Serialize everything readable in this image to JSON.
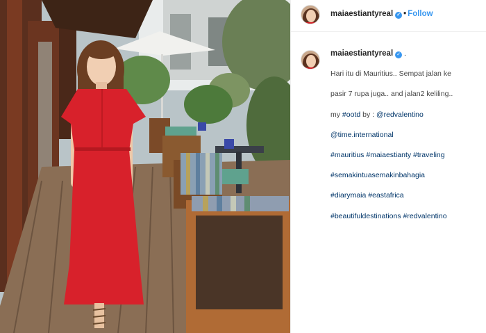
{
  "post": {
    "username": "maiaestiantyreal",
    "verified_icon": "verified-badge-icon",
    "separator": "•",
    "follow_label": "Follow"
  },
  "caption": {
    "username": "maiaestiantyreal",
    "line1": "Hari itu di Mauritius.. Sempat jalan ke",
    "line2": "pasir 7 rupa juga.. and jalan2 keliling..",
    "line3_prefix": "my ",
    "line3_tag": "#ootd",
    "line3_mid": " by : ",
    "line3_mention": "@redvalentino",
    "mention2": "@time.international",
    "tags_line1": "#mauritius #maiaestianty #traveling",
    "tags_line2": "#semakintuasemakinbahagia",
    "tags_line3": "#diarymaia #eastafrica",
    "tags_line4": "#beautifuldestinations #redvalentino"
  },
  "colors": {
    "accent": "#3897f0",
    "dress": "#d8212b",
    "link": "#003569"
  }
}
